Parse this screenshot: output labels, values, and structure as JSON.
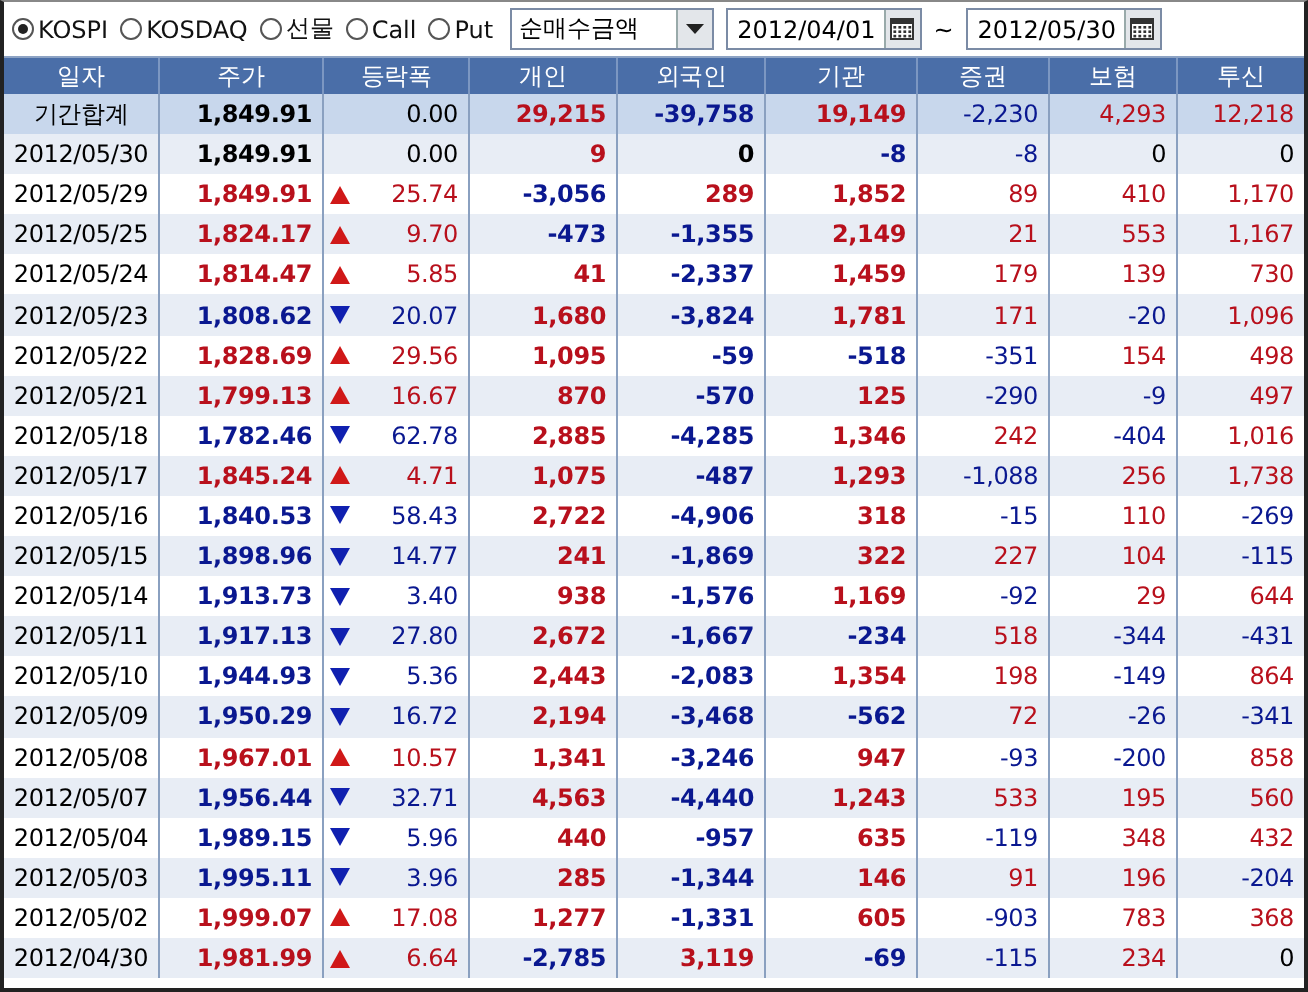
{
  "market_options": [
    {
      "label": "KOSPI",
      "selected": true
    },
    {
      "label": "KOSDAQ",
      "selected": false
    },
    {
      "label": "선물",
      "selected": false
    },
    {
      "label": "Call",
      "selected": false
    },
    {
      "label": "Put",
      "selected": false
    }
  ],
  "metric_dropdown": {
    "value": "순매수금액"
  },
  "date_range": {
    "start": "2012/04/01",
    "separator": "~",
    "end": "2012/05/30"
  },
  "table": {
    "columns": [
      "일자",
      "주가",
      "등락폭",
      "개인",
      "외국인",
      "기관",
      "증권",
      "보험",
      "투신"
    ],
    "summary": {
      "label": "기간합계",
      "price": "1,849.91",
      "change": "0.00",
      "values": [
        "29,215",
        "-39,758",
        "19,149",
        "-2,230",
        "4,293",
        "12,218"
      ]
    },
    "rows": [
      {
        "date": "2012/05/30",
        "price": "1,849.91",
        "kind": "flat",
        "change": "0.00",
        "values": [
          "9",
          "0",
          "-8",
          "-8",
          "0",
          "0"
        ]
      },
      {
        "date": "2012/05/29",
        "price": "1,849.91",
        "kind": "up",
        "change": "25.74",
        "values": [
          "-3,056",
          "289",
          "1,852",
          "89",
          "410",
          "1,170"
        ]
      },
      {
        "date": "2012/05/25",
        "price": "1,824.17",
        "kind": "up",
        "change": "9.70",
        "values": [
          "-473",
          "-1,355",
          "2,149",
          "21",
          "553",
          "1,167"
        ]
      },
      {
        "date": "2012/05/24",
        "price": "1,814.47",
        "kind": "up",
        "change": "5.85",
        "values": [
          "41",
          "-2,337",
          "1,459",
          "179",
          "139",
          "730"
        ]
      },
      {
        "date": "2012/05/23",
        "price": "1,808.62",
        "kind": "down",
        "change": "20.07",
        "values": [
          "1,680",
          "-3,824",
          "1,781",
          "171",
          "-20",
          "1,096"
        ]
      },
      {
        "date": "2012/05/22",
        "price": "1,828.69",
        "kind": "up",
        "change": "29.56",
        "values": [
          "1,095",
          "-59",
          "-518",
          "-351",
          "154",
          "498"
        ]
      },
      {
        "date": "2012/05/21",
        "price": "1,799.13",
        "kind": "up",
        "change": "16.67",
        "values": [
          "870",
          "-570",
          "125",
          "-290",
          "-9",
          "497"
        ]
      },
      {
        "date": "2012/05/18",
        "price": "1,782.46",
        "kind": "down",
        "change": "62.78",
        "values": [
          "2,885",
          "-4,285",
          "1,346",
          "242",
          "-404",
          "1,016"
        ]
      },
      {
        "date": "2012/05/17",
        "price": "1,845.24",
        "kind": "up",
        "change": "4.71",
        "values": [
          "1,075",
          "-487",
          "1,293",
          "-1,088",
          "256",
          "1,738"
        ]
      },
      {
        "date": "2012/05/16",
        "price": "1,840.53",
        "kind": "down",
        "change": "58.43",
        "values": [
          "2,722",
          "-4,906",
          "318",
          "-15",
          "110",
          "-269"
        ]
      },
      {
        "date": "2012/05/15",
        "price": "1,898.96",
        "kind": "down",
        "change": "14.77",
        "values": [
          "241",
          "-1,869",
          "322",
          "227",
          "104",
          "-115"
        ]
      },
      {
        "date": "2012/05/14",
        "price": "1,913.73",
        "kind": "down",
        "change": "3.40",
        "values": [
          "938",
          "-1,576",
          "1,169",
          "-92",
          "29",
          "644"
        ]
      },
      {
        "date": "2012/05/11",
        "price": "1,917.13",
        "kind": "down",
        "change": "27.80",
        "values": [
          "2,672",
          "-1,667",
          "-234",
          "518",
          "-344",
          "-431"
        ]
      },
      {
        "date": "2012/05/10",
        "price": "1,944.93",
        "kind": "down",
        "change": "5.36",
        "values": [
          "2,443",
          "-2,083",
          "1,354",
          "198",
          "-149",
          "864"
        ]
      },
      {
        "date": "2012/05/09",
        "price": "1,950.29",
        "kind": "down",
        "change": "16.72",
        "values": [
          "2,194",
          "-3,468",
          "-562",
          "72",
          "-26",
          "-341"
        ]
      },
      {
        "date": "2012/05/08",
        "price": "1,967.01",
        "kind": "up",
        "change": "10.57",
        "values": [
          "1,341",
          "-3,246",
          "947",
          "-93",
          "-200",
          "858"
        ]
      },
      {
        "date": "2012/05/07",
        "price": "1,956.44",
        "kind": "down",
        "change": "32.71",
        "values": [
          "4,563",
          "-4,440",
          "1,243",
          "533",
          "195",
          "560"
        ]
      },
      {
        "date": "2012/05/04",
        "price": "1,989.15",
        "kind": "down",
        "change": "5.96",
        "values": [
          "440",
          "-957",
          "635",
          "-119",
          "348",
          "432"
        ]
      },
      {
        "date": "2012/05/03",
        "price": "1,995.11",
        "kind": "down",
        "change": "3.96",
        "values": [
          "285",
          "-1,344",
          "146",
          "91",
          "196",
          "-204"
        ]
      },
      {
        "date": "2012/05/02",
        "price": "1,999.07",
        "kind": "up",
        "change": "17.08",
        "values": [
          "1,277",
          "-1,331",
          "605",
          "-903",
          "783",
          "368"
        ]
      },
      {
        "date": "2012/04/30",
        "price": "1,981.99",
        "kind": "up",
        "change": "6.64",
        "values": [
          "-2,785",
          "3,119",
          "-69",
          "-115",
          "234",
          "0"
        ]
      }
    ]
  }
}
